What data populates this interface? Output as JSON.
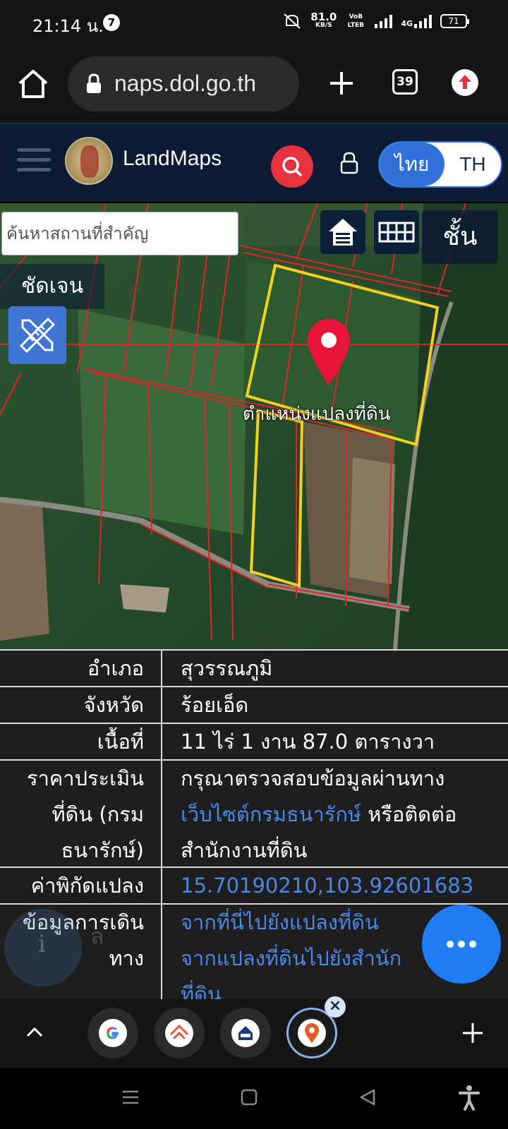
{
  "status_bar": {
    "time": "21:14 น.",
    "notification_count": "7",
    "net_speed": "81.0",
    "net_unit": "KB/S",
    "volte": "VoB LTEB",
    "network": "4G",
    "battery": "71"
  },
  "browser": {
    "url": "naps.dol.go.th",
    "tab_count": "39"
  },
  "app_header": {
    "app_name": "LandMaps",
    "lang_active": "ไทย",
    "lang_inactive": "TH"
  },
  "map": {
    "search_placeholder": "ค้นหาสถานที่สำคัญ",
    "layer_button": "ชั้น",
    "clarity_button": "ชัดเจน",
    "parcel_label": "ตำแหน่งแปลงที่ดิน"
  },
  "info_table": {
    "rows": [
      {
        "label": "อำเภอ",
        "value": "สุวรรณภูมิ"
      },
      {
        "label": "จังหวัด",
        "value": "ร้อยเอ็ด"
      },
      {
        "label": "เนื้อที่",
        "value": "11 ไร่ 1 งาน 87.0 ตารางวา"
      },
      {
        "label_lines": [
          "ราคาประเมิน",
          "ที่ดิน (กรม",
          "ธนารักษ์)"
        ],
        "value_line1": "กรุณาตรวจสอบข้อมูลผ่านทาง",
        "value_link": "เว็บไซต์กรมธนารักษ์",
        "value_after_link": " หรือติดต่อ",
        "value_line3": "สำนักงานที่ดิน"
      },
      {
        "label": "ค่าพิกัดแปลง",
        "value": "15.70190210,103.92601683"
      },
      {
        "label_lines": [
          "ข้อมูลการเดิน",
          "ทาง"
        ],
        "links": [
          "จากที่นี่ไปยังแปลงที่ดิน",
          "จากแปลงที่ดินไปยังสำนัก",
          "ที่ดิน"
        ]
      }
    ],
    "info_icon": "i",
    "ghost_char": "ล"
  },
  "icons": {
    "home": "home-icon",
    "lock": "lock-icon",
    "plus": "plus-icon",
    "update": "update-arrow-icon",
    "menu": "hamburger-icon",
    "search": "search-icon",
    "user_lock": "lock-icon",
    "map_home": "home-icon",
    "grid": "grid-icon",
    "measure": "ruler-pencil-icon",
    "pin": "map-pin-icon",
    "more": "more-dots-icon"
  },
  "colors": {
    "header_bg": "#0a1b33",
    "accent_red": "#e8333f",
    "accent_blue": "#2f71d6",
    "link_blue": "#4a88e8",
    "parcel_yellow": "#f2d21a",
    "boundary_red": "#e0242a"
  }
}
